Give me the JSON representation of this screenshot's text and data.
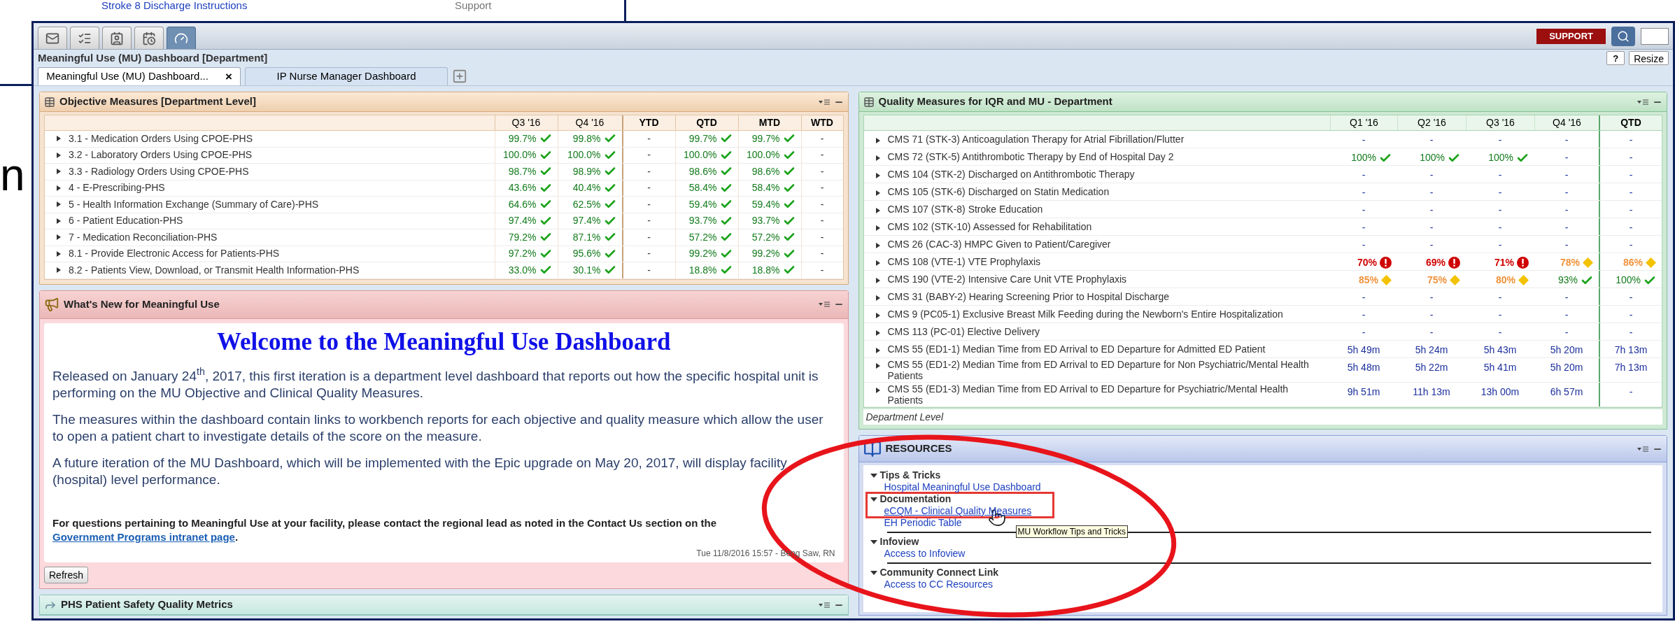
{
  "background": {
    "link_text": "Stroke 8 Discharge Instructions",
    "column_text": "Support",
    "slide_fragment": "n"
  },
  "toolbar": {
    "tabs": [
      {
        "selected": false
      },
      {
        "selected": false
      },
      {
        "selected": false
      },
      {
        "selected": false
      },
      {
        "selected": true
      }
    ],
    "support_button": "SUPPORT"
  },
  "window": {
    "title": "Meaningful Use (MU) Dashboard [Department]",
    "help_button": "?",
    "resize_button": "Resize"
  },
  "tabs": [
    {
      "label": "Meaningful Use (MU) Dashboard...",
      "selected": true,
      "close": "×"
    },
    {
      "label": "IP Nurse Manager Dashboard",
      "selected": false
    }
  ],
  "objective_measures": {
    "title": "Objective Measures [Department Level]",
    "columns": [
      "Q3 '16",
      "Q4 '16",
      "YTD",
      "QTD",
      "MTD",
      "WTD"
    ],
    "rows": [
      {
        "name": "3.1 - Medication Orders Using CPOE-PHS",
        "cells": [
          {
            "value": "99.7%",
            "kind": "ok"
          },
          {
            "value": "99.8%",
            "kind": "ok"
          },
          {
            "value": "-",
            "kind": "none"
          },
          {
            "value": "99.7%",
            "kind": "ok"
          },
          {
            "value": "99.7%",
            "kind": "ok"
          },
          {
            "value": "-",
            "kind": "none"
          }
        ]
      },
      {
        "name": "3.2 - Laboratory Orders Using CPOE-PHS",
        "cells": [
          {
            "value": "100.0%",
            "kind": "ok"
          },
          {
            "value": "100.0%",
            "kind": "ok"
          },
          {
            "value": "-",
            "kind": "none"
          },
          {
            "value": "100.0%",
            "kind": "ok"
          },
          {
            "value": "100.0%",
            "kind": "ok"
          },
          {
            "value": "-",
            "kind": "none"
          }
        ]
      },
      {
        "name": "3.3 - Radiology Orders Using CPOE-PHS",
        "cells": [
          {
            "value": "98.7%",
            "kind": "ok"
          },
          {
            "value": "98.9%",
            "kind": "ok"
          },
          {
            "value": "-",
            "kind": "none"
          },
          {
            "value": "98.6%",
            "kind": "ok"
          },
          {
            "value": "98.6%",
            "kind": "ok"
          },
          {
            "value": "-",
            "kind": "none"
          }
        ]
      },
      {
        "name": "4 - E-Prescribing-PHS",
        "cells": [
          {
            "value": "43.6%",
            "kind": "ok"
          },
          {
            "value": "40.4%",
            "kind": "ok"
          },
          {
            "value": "-",
            "kind": "none"
          },
          {
            "value": "58.4%",
            "kind": "ok"
          },
          {
            "value": "58.4%",
            "kind": "ok"
          },
          {
            "value": "-",
            "kind": "none"
          }
        ]
      },
      {
        "name": "5 - Health Information Exchange (Summary of Care)-PHS",
        "cells": [
          {
            "value": "64.6%",
            "kind": "ok"
          },
          {
            "value": "62.5%",
            "kind": "ok"
          },
          {
            "value": "-",
            "kind": "none"
          },
          {
            "value": "59.4%",
            "kind": "ok"
          },
          {
            "value": "59.4%",
            "kind": "ok"
          },
          {
            "value": "-",
            "kind": "none"
          }
        ]
      },
      {
        "name": "6 - Patient Education-PHS",
        "cells": [
          {
            "value": "97.4%",
            "kind": "ok"
          },
          {
            "value": "97.4%",
            "kind": "ok"
          },
          {
            "value": "-",
            "kind": "none"
          },
          {
            "value": "93.7%",
            "kind": "ok"
          },
          {
            "value": "93.7%",
            "kind": "ok"
          },
          {
            "value": "-",
            "kind": "none"
          }
        ]
      },
      {
        "name": "7 - Medication Reconciliation-PHS",
        "cells": [
          {
            "value": "79.2%",
            "kind": "ok"
          },
          {
            "value": "87.1%",
            "kind": "ok"
          },
          {
            "value": "-",
            "kind": "none"
          },
          {
            "value": "57.2%",
            "kind": "ok"
          },
          {
            "value": "57.2%",
            "kind": "ok"
          },
          {
            "value": "-",
            "kind": "none"
          }
        ]
      },
      {
        "name": "8.1 - Provide Electronic Access for Patients-PHS",
        "cells": [
          {
            "value": "97.2%",
            "kind": "ok"
          },
          {
            "value": "95.6%",
            "kind": "ok"
          },
          {
            "value": "-",
            "kind": "none"
          },
          {
            "value": "99.2%",
            "kind": "ok"
          },
          {
            "value": "99.2%",
            "kind": "ok"
          },
          {
            "value": "-",
            "kind": "none"
          }
        ]
      },
      {
        "name": "8.2 - Patients View, Download, or Transmit Health Information-PHS",
        "cells": [
          {
            "value": "33.0%",
            "kind": "ok"
          },
          {
            "value": "30.1%",
            "kind": "ok"
          },
          {
            "value": "-",
            "kind": "none"
          },
          {
            "value": "18.8%",
            "kind": "ok"
          },
          {
            "value": "18.8%",
            "kind": "ok"
          },
          {
            "value": "-",
            "kind": "none"
          }
        ]
      }
    ]
  },
  "whats_new": {
    "title": "What's New for Meaningful Use",
    "heading": "Welcome to the Meaningful Use Dashboard",
    "paragraphs": [
      "Released on January 24$^{th}$, 2017, this first iteration is a department level dashboard that reports out how the specific hospital unit is performing on the MU Objective and Clinical Quality Measures.",
      "The measures within the dashboard contain links to workbench reports for each objective and quality measure which allow the user to open a patient chart to investigate details of the score on the measure.",
      "A future iteration of the MU Dashboard, which will be implemented with the Epic upgrade on May 20, 2017, will display facility (hospital) level performance."
    ],
    "contact": {
      "text": "For questions pertaining to Meaningful Use at your facility, please contact the regional lead as noted in the Contact Us section on the",
      "link": "Government Programs intranet page",
      "after": "."
    },
    "timestamp": "Tue 11/8/2016 15:57 - Beng Saw, RN",
    "refresh_button": "Refresh"
  },
  "patient_safety": {
    "title": "PHS Patient Safety Quality Metrics"
  },
  "quality_measures": {
    "title": "Quality Measures for IQR and MU - Department",
    "columns": [
      "Q1 '16",
      "Q2 '16",
      "Q3 '16",
      "Q4 '16",
      "QTD"
    ],
    "rows": [
      {
        "name": "CMS 71 (STK-3) Anticoagulation Therapy for Atrial Fibrillation/Flutter",
        "cells": [
          {
            "value": "-",
            "kind": "none"
          },
          {
            "value": "-",
            "kind": "none"
          },
          {
            "value": "-",
            "kind": "none"
          },
          {
            "value": "-",
            "kind": "none"
          },
          {
            "value": "-",
            "kind": "none"
          }
        ]
      },
      {
        "name": "CMS 72 (STK-5) Antithrombotic Therapy by End of Hospital Day 2",
        "cells": [
          {
            "value": "100%",
            "kind": "ok"
          },
          {
            "value": "100%",
            "kind": "ok"
          },
          {
            "value": "100%",
            "kind": "ok"
          },
          {
            "value": "-",
            "kind": "none"
          },
          {
            "value": "-",
            "kind": "none"
          }
        ]
      },
      {
        "name": "CMS 104 (STK-2) Discharged on Antithrombotic Therapy",
        "cells": [
          {
            "value": "-",
            "kind": "none"
          },
          {
            "value": "-",
            "kind": "none"
          },
          {
            "value": "-",
            "kind": "none"
          },
          {
            "value": "-",
            "kind": "none"
          },
          {
            "value": "-",
            "kind": "none"
          }
        ]
      },
      {
        "name": "CMS 105 (STK-6) Discharged on Statin Medication",
        "cells": [
          {
            "value": "-",
            "kind": "none"
          },
          {
            "value": "-",
            "kind": "none"
          },
          {
            "value": "-",
            "kind": "none"
          },
          {
            "value": "-",
            "kind": "none"
          },
          {
            "value": "-",
            "kind": "none"
          }
        ]
      },
      {
        "name": "CMS 107 (STK-8) Stroke Education",
        "cells": [
          {
            "value": "-",
            "kind": "none"
          },
          {
            "value": "-",
            "kind": "none"
          },
          {
            "value": "-",
            "kind": "none"
          },
          {
            "value": "-",
            "kind": "none"
          },
          {
            "value": "-",
            "kind": "none"
          }
        ]
      },
      {
        "name": "CMS 102 (STK-10) Assessed for Rehabilitation",
        "cells": [
          {
            "value": "-",
            "kind": "none"
          },
          {
            "value": "-",
            "kind": "none"
          },
          {
            "value": "-",
            "kind": "none"
          },
          {
            "value": "-",
            "kind": "none"
          },
          {
            "value": "-",
            "kind": "none"
          }
        ]
      },
      {
        "name": "CMS 26 (CAC-3) HMPC Given to Patient/Caregiver",
        "cells": [
          {
            "value": "-",
            "kind": "none"
          },
          {
            "value": "-",
            "kind": "none"
          },
          {
            "value": "-",
            "kind": "none"
          },
          {
            "value": "-",
            "kind": "none"
          },
          {
            "value": "-",
            "kind": "none"
          }
        ]
      },
      {
        "name": "CMS 108 (VTE-1) VTE Prophylaxis",
        "cells": [
          {
            "value": "70%",
            "kind": "bad"
          },
          {
            "value": "69%",
            "kind": "bad"
          },
          {
            "value": "71%",
            "kind": "bad"
          },
          {
            "value": "78%",
            "kind": "warn"
          },
          {
            "value": "86%",
            "kind": "warn"
          }
        ]
      },
      {
        "name": "CMS 190 (VTE-2) Intensive Care Unit VTE Prophylaxis",
        "cells": [
          {
            "value": "85%",
            "kind": "warn"
          },
          {
            "value": "75%",
            "kind": "warn"
          },
          {
            "value": "80%",
            "kind": "warn"
          },
          {
            "value": "93%",
            "kind": "ok"
          },
          {
            "value": "100%",
            "kind": "ok"
          }
        ]
      },
      {
        "name": "CMS 31 (BABY-2) Hearing Screening Prior to Hospital Discharge",
        "cells": [
          {
            "value": "-",
            "kind": "none"
          },
          {
            "value": "-",
            "kind": "none"
          },
          {
            "value": "-",
            "kind": "none"
          },
          {
            "value": "-",
            "kind": "none"
          },
          {
            "value": "-",
            "kind": "none"
          }
        ]
      },
      {
        "name": "CMS 9 (PC05-1) Exclusive Breast Milk Feeding during the Newborn's Entire Hospitalization",
        "cells": [
          {
            "value": "-",
            "kind": "none"
          },
          {
            "value": "-",
            "kind": "none"
          },
          {
            "value": "-",
            "kind": "none"
          },
          {
            "value": "-",
            "kind": "none"
          },
          {
            "value": "-",
            "kind": "none"
          }
        ]
      },
      {
        "name": "CMS 113 (PC-01) Elective Delivery",
        "cells": [
          {
            "value": "-",
            "kind": "none"
          },
          {
            "value": "-",
            "kind": "none"
          },
          {
            "value": "-",
            "kind": "none"
          },
          {
            "value": "-",
            "kind": "none"
          },
          {
            "value": "-",
            "kind": "none"
          }
        ]
      },
      {
        "name": "CMS 55 (ED1-1) Median Time from ED Arrival to ED Departure for Admitted ED Patient",
        "cells": [
          {
            "value": "5h 49m",
            "kind": "time"
          },
          {
            "value": "5h 24m",
            "kind": "time"
          },
          {
            "value": "5h 43m",
            "kind": "time"
          },
          {
            "value": "5h 20m",
            "kind": "time"
          },
          {
            "value": "7h 13m",
            "kind": "time"
          }
        ]
      },
      {
        "name": "CMS 55 (ED1-2) Median Time from ED Arrival to ED Departure for Non Psychiatric/Mental Health Patients",
        "cells": [
          {
            "value": "5h 48m",
            "kind": "time"
          },
          {
            "value": "5h 22m",
            "kind": "time"
          },
          {
            "value": "5h 41m",
            "kind": "time"
          },
          {
            "value": "5h 20m",
            "kind": "time"
          },
          {
            "value": "7h 13m",
            "kind": "time"
          }
        ]
      },
      {
        "name": "CMS 55 (ED1-3) Median Time from ED Arrival to ED Departure for Psychiatric/Mental Health Patients",
        "cells": [
          {
            "value": "9h 51m",
            "kind": "time"
          },
          {
            "value": "11h 13m",
            "kind": "time"
          },
          {
            "value": "13h 00m",
            "kind": "time"
          },
          {
            "value": "6h 57m",
            "kind": "time"
          },
          {
            "value": "-",
            "kind": "none"
          }
        ]
      }
    ],
    "footer": "Department Level"
  },
  "resources": {
    "title": "RESOURCES",
    "sections": [
      {
        "title": "Tips & Tricks",
        "expanded": true,
        "boxed": false,
        "links": [
          "Hospital Meaningful Use Dashboard"
        ]
      },
      {
        "title": "Documentation",
        "expanded": true,
        "boxed": true,
        "links": [
          "eCQM - Clinical Quality Measures",
          "EH Periodic Table"
        ]
      },
      {
        "title": "Infoview",
        "expanded": true,
        "boxed": false,
        "links": [
          "Access to Infoview"
        ]
      },
      {
        "title": "Community Connect Link",
        "expanded": true,
        "boxed": false,
        "links": [
          "Access to CC Resources"
        ]
      }
    ],
    "tooltip": "MU Workflow Tips and Tricks"
  }
}
